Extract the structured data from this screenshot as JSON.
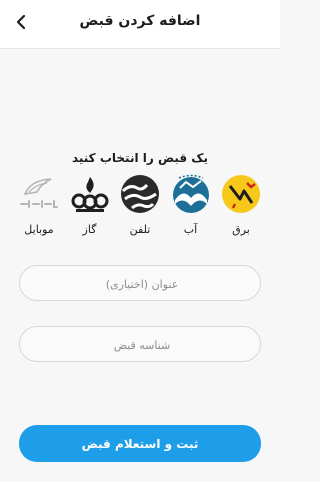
{
  "header": {
    "title": "اضافه کردن قبض"
  },
  "section": {
    "title": "یک قبض را انتخاب کنید"
  },
  "bills": [
    {
      "label": "برق",
      "icon": "electricity-icon",
      "color": "#f6c81a"
    },
    {
      "label": "آب",
      "icon": "water-icon",
      "color": "#1e6f98"
    },
    {
      "label": "تلفن",
      "icon": "telephone-icon",
      "color": "#2a2a2a"
    },
    {
      "label": "گاز",
      "icon": "gas-icon",
      "color": "#1f1f1f"
    },
    {
      "label": "موبایل",
      "icon": "mobile-icon",
      "color": "#b5b5b5"
    }
  ],
  "fields": {
    "title_placeholder": "عنوان (اختیاری)",
    "bill_id_placeholder": "شناسه قبض"
  },
  "submit": {
    "label": "ثبت و استعلام قبض",
    "color": "#1e9ee9"
  }
}
